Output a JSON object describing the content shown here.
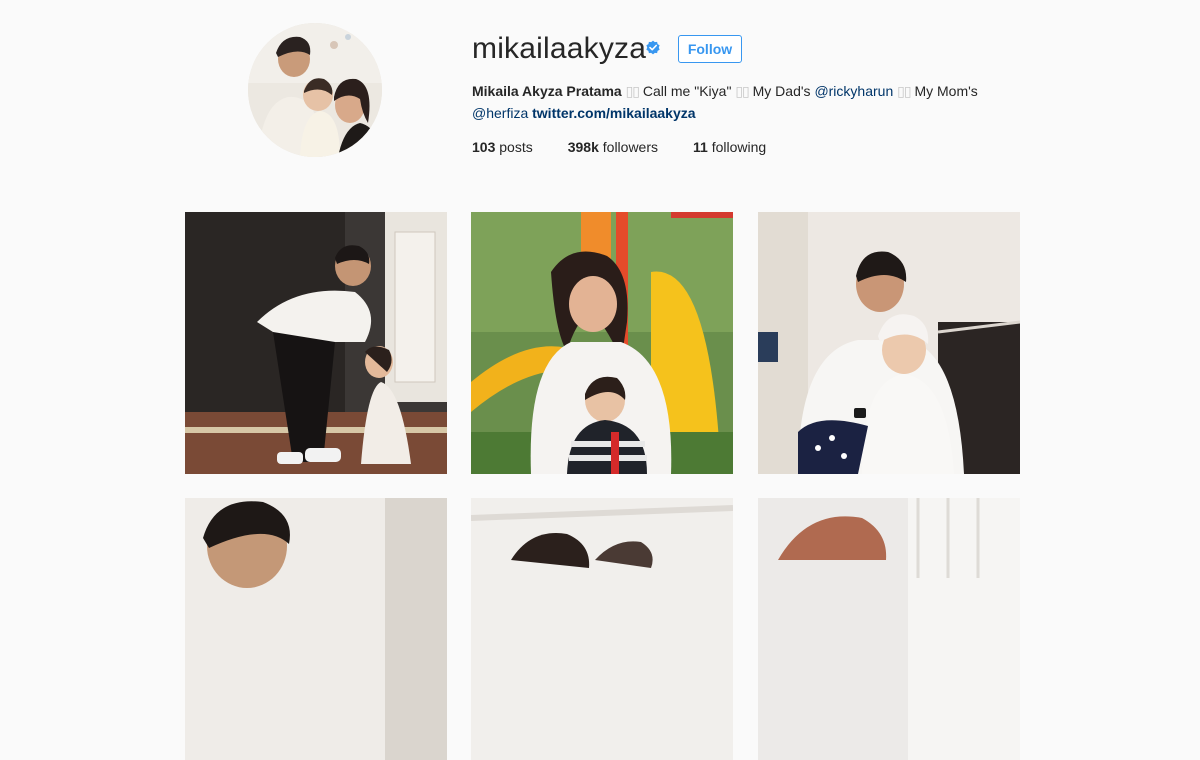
{
  "profile": {
    "username": "mikailaakyza",
    "follow_label": "Follow",
    "verified_icon": "verified-badge-icon",
    "accent_color": "#3897f0"
  },
  "bio": {
    "name": "Mikaila Akyza Pratama",
    "glyph": "▯▯",
    "part1": "Call me \"Kiya\"",
    "part2": "My Dad's",
    "mention_dad": "@rickyharun",
    "part3": "My Mom's",
    "mention_mom": "@herfiza",
    "link": "twitter.com/mikailaakyza"
  },
  "stats": {
    "posts_count": "103",
    "posts_label": "posts",
    "followers_count": "398k",
    "followers_label": "followers",
    "following_count": "11",
    "following_label": "following"
  }
}
